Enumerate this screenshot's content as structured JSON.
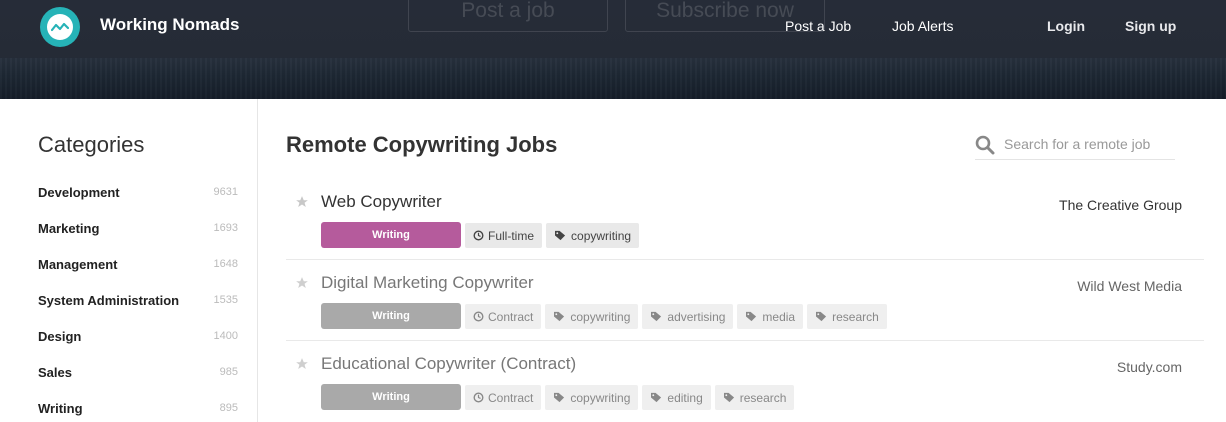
{
  "header": {
    "brand": "Working Nomads",
    "ghost_post": "Post a job",
    "ghost_subscribe": "Subscribe now",
    "nav": {
      "post_job": "Post a Job",
      "job_alerts": "Job Alerts",
      "login": "Login",
      "signup": "Sign up"
    }
  },
  "sidebar": {
    "title": "Categories",
    "items": [
      {
        "label": "Development",
        "count": "9631"
      },
      {
        "label": "Marketing",
        "count": "1693"
      },
      {
        "label": "Management",
        "count": "1648"
      },
      {
        "label": "System Administration",
        "count": "1535"
      },
      {
        "label": "Design",
        "count": "1400"
      },
      {
        "label": "Sales",
        "count": "985"
      },
      {
        "label": "Writing",
        "count": "895"
      }
    ]
  },
  "main": {
    "title": "Remote Copywriting Jobs",
    "search": {
      "placeholder": "Search for a remote job"
    },
    "jobs": [
      {
        "title": "Web Copywriter",
        "company": "The Creative Group",
        "category": "Writing",
        "category_color": "#b55b9c",
        "type": "Full-time",
        "tags": [
          "copywriting"
        ]
      },
      {
        "title": "Digital Marketing Copywriter",
        "company": "Wild West Media",
        "category": "Writing",
        "category_color": "#a9a9a9",
        "type": "Contract",
        "tags": [
          "copywriting",
          "advertising",
          "media",
          "research"
        ]
      },
      {
        "title": "Educational Copywriter (Contract)",
        "company": "Study.com",
        "category": "Writing",
        "category_color": "#a9a9a9",
        "type": "Contract",
        "tags": [
          "copywriting",
          "editing",
          "research"
        ]
      }
    ]
  },
  "colors": {
    "header_bg": "#262c38",
    "logo": "#26b3b7",
    "active_category": "#b55b9c"
  },
  "icons": {
    "logo": "wave-logo-icon",
    "search": "search-icon",
    "star": "star-icon",
    "clock": "clock-icon",
    "tag": "tag-icon"
  }
}
